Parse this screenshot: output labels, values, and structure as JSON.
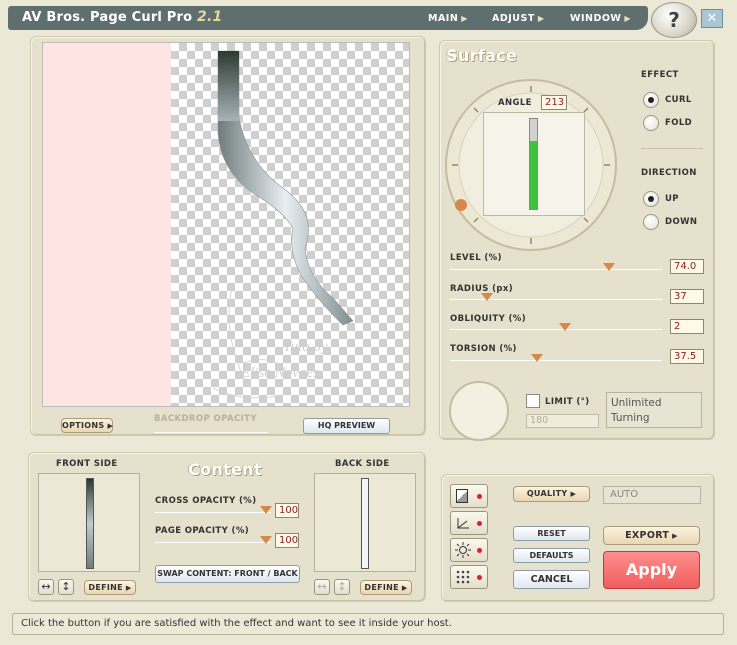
{
  "title": {
    "name": "AV Bros. Page Curl Pro",
    "version": "2.1"
  },
  "menu": [
    {
      "label": "MAIN"
    },
    {
      "label": "ADJUST"
    },
    {
      "label": "WINDOW"
    }
  ],
  "help_label": "?",
  "close_label": "✕",
  "preview": {
    "watermark_line1": "Tuto by",
    "watermark_line2": "Elise Novaes",
    "options_label": "OPTIONS",
    "backdrop_label": "BACKDROP OPACITY",
    "hq_preview_label": "HQ PREVIEW"
  },
  "surface": {
    "header": "Surface",
    "angle_label": "ANGLE",
    "angle_value": "213",
    "effect_label": "EFFECT",
    "effect_options": [
      "CURL",
      "FOLD"
    ],
    "effect_selected": "CURL",
    "direction_label": "DIRECTION",
    "direction_options": [
      "UP",
      "DOWN"
    ],
    "direction_selected": "UP",
    "sliders": [
      {
        "label": "LEVEL (%)",
        "value": "74.0",
        "fraction": 0.74
      },
      {
        "label": "RADIUS (px)",
        "value": "37",
        "fraction": 0.16
      },
      {
        "label": "OBLIQUITY (%)",
        "value": "2",
        "fraction": 0.52
      },
      {
        "label": "TORSION (%)",
        "value": "37.5",
        "fraction": 0.41
      }
    ],
    "limit_label": "LIMIT (°)",
    "limit_value": "180",
    "limit_note": "Unlimited Turning"
  },
  "content": {
    "header": "Content",
    "front_label": "FRONT SIDE",
    "back_label": "BACK SIDE",
    "cross_opacity_label": "CROSS OPACITY (%)",
    "cross_opacity_value": "100",
    "page_opacity_label": "PAGE OPACITY (%)",
    "page_opacity_value": "100",
    "swap_label": "SWAP CONTENT: FRONT / BACK",
    "define_label": "DEFINE",
    "flip_h": "↔",
    "flip_v": "↕"
  },
  "actions": {
    "quality_label": "QUALITY",
    "quality_value": "AUTO",
    "reset_label": "RESET",
    "defaults_label": "DEFAULTS",
    "cancel_label": "CANCEL",
    "export_label": "EXPORT",
    "apply_label": "Apply"
  },
  "status_text": "Click the button if you are satisfied with the effect and want to see it inside your host.",
  "colors": {
    "accent": "#d7894a",
    "apply": "#f56a6a",
    "titlebar": "#5f6f6f"
  },
  "icons": [
    "page-fold-icon",
    "axis-icon",
    "light-icon",
    "grid-dots-icon"
  ]
}
